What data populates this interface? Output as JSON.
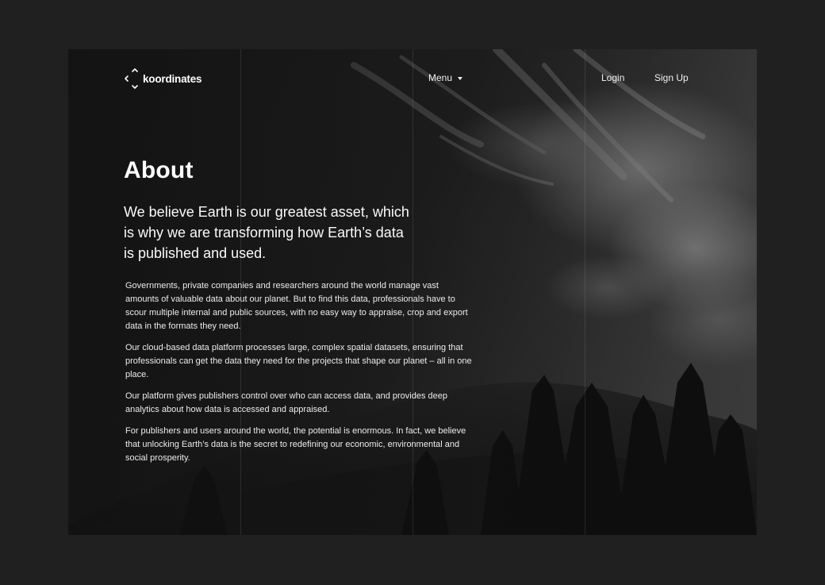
{
  "brand": {
    "name": "koordinates"
  },
  "nav": {
    "menu_label": "Menu",
    "login_label": "Login",
    "signup_label": "Sign Up"
  },
  "main": {
    "title": "About",
    "lead": "We believe Earth is our greatest asset, which is why we are transforming how Earth’s data is published and used.",
    "paragraphs": [
      "Governments, private companies and researchers around the world manage vast amounts of valuable data about our planet. But to find this data, professionals have to scour multiple internal and public sources, with no easy way to appraise, crop and export data in the formats they need.",
      "Our cloud-based data platform processes large, complex spatial datasets, ensuring that professionals can get the data they need for the projects that shape our planet – all in one place.",
      "Our platform gives publishers control over who can access data, and provides deep analytics about how data is accessed and appraised.",
      "For publishers and users around the world, the potential is enormous. In fact, we believe that unlocking Earth’s data is the secret to redefining our economic, environmental and social prosperity."
    ]
  },
  "colors": {
    "page_background": "#202020",
    "hero_background": "#191919",
    "text": "#ffffff"
  },
  "icons": {
    "logo": "koordinates-logo-mark",
    "menu_caret": "caret-down-icon"
  }
}
